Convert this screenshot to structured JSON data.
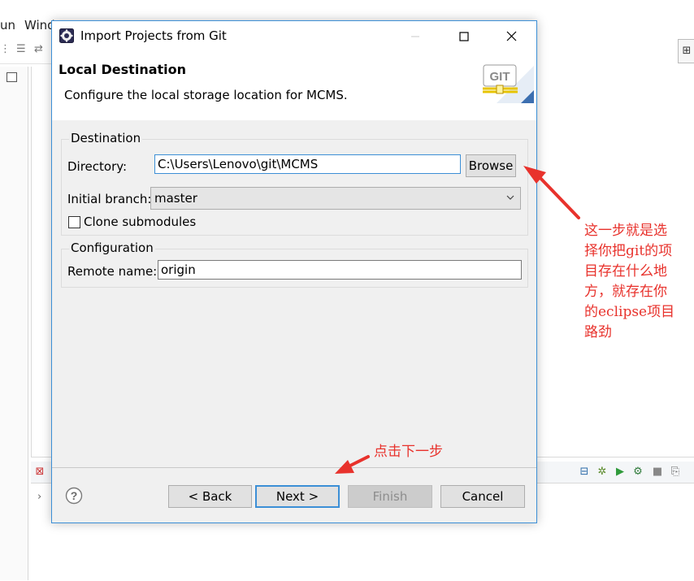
{
  "background": {
    "menu_items": [
      "un",
      "Wind"
    ]
  },
  "dialog": {
    "title": "Import Projects from Git",
    "header": {
      "title": "Local Destination",
      "description": "Configure the local storage location for MCMS."
    },
    "destination_group": {
      "title": "Destination",
      "directory_label": "Directory:",
      "directory_value": "C:\\Users\\Lenovo\\git\\MCMS",
      "browse_label": "Browse",
      "branch_label": "Initial branch:",
      "branch_value": "master",
      "clone_submodules_label": "Clone submodules",
      "clone_submodules_checked": false
    },
    "configuration_group": {
      "title": "Configuration",
      "remote_name_label": "Remote name:",
      "remote_name_value": "origin"
    },
    "buttons": {
      "back": "< Back",
      "next": "Next >",
      "finish": "Finish",
      "cancel": "Cancel"
    }
  },
  "annotations": {
    "main_lines": [
      "这一步就是选",
      "择你把git的项",
      "目存在什么地",
      "方，就存在你",
      "的eclipse项目",
      "路劲"
    ],
    "next": "点击下一步"
  },
  "colors": {
    "accent": "#3c8fd6",
    "annotation": "#e8322c"
  }
}
